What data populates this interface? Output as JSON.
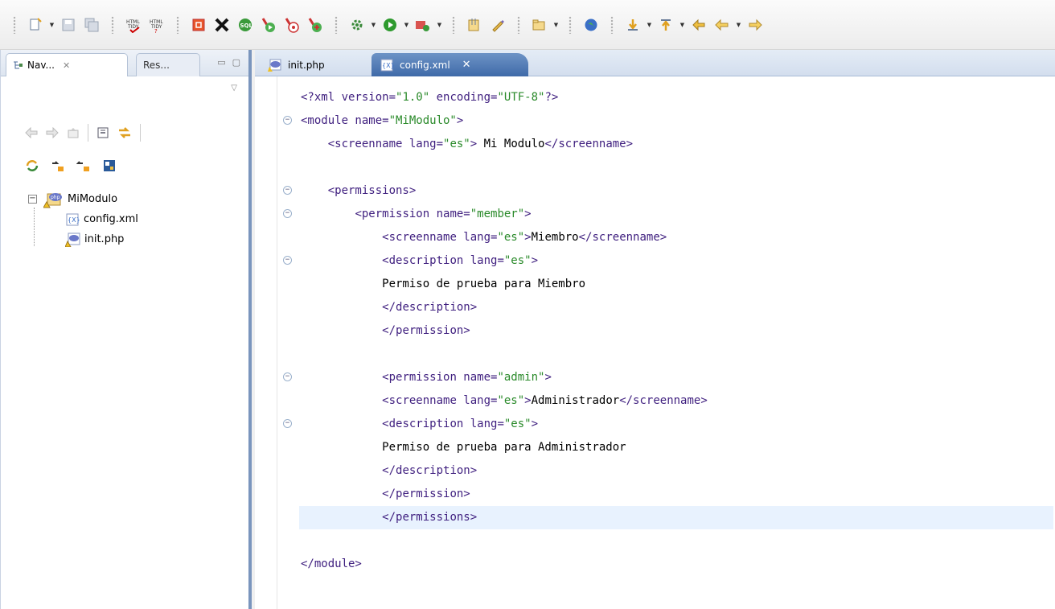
{
  "toolbar": {
    "groups": [
      [
        "new-wizard",
        "save",
        "save-all"
      ],
      [
        "html-tidy-fix",
        "html-tidy-check"
      ],
      [
        "open-app",
        "terminate",
        "sql-explorer",
        "run-php",
        "debug-php",
        "profile-php"
      ],
      [
        "settings",
        "run",
        "external-tools"
      ],
      [
        "open-resource",
        "spell-check"
      ],
      [
        "new-folder"
      ],
      [
        "browser"
      ],
      [
        "next-annotation",
        "previous-annotation",
        "last-edit",
        "back",
        "forward"
      ]
    ]
  },
  "navigator": {
    "tab_label": "Nav...",
    "tab_close": "✕",
    "other_tab_label": "Res...",
    "tree": {
      "project": "MiModulo",
      "files": [
        "config.xml",
        "init.php"
      ]
    }
  },
  "editor": {
    "tabs": [
      {
        "label": "init.php",
        "active": false
      },
      {
        "label": "config.xml",
        "active": true
      }
    ],
    "close_glyph": "✕",
    "lines": [
      "<?xml version=\"1.0\" encoding=\"UTF-8\"?>",
      "<module name=\"MiModulo\">",
      "    <screenname lang=\"es\"> Mi Modulo</screenname>",
      "",
      "    <permissions>",
      "        <permission name=\"member\">",
      "            <screenname lang=\"es\">Miembro</screenname>",
      "            <description lang=\"es\">",
      "            Permiso de prueba para Miembro",
      "            </description>",
      "            </permission>",
      "",
      "            <permission name=\"admin\">",
      "            <screenname lang=\"es\">Administrador</screenname>",
      "            <description lang=\"es\">",
      "            Permiso de prueba para Administrador",
      "            </description>",
      "            </permission>",
      "            </permissions>",
      "",
      "</module>"
    ],
    "fold_lines": [
      1,
      4,
      5,
      7,
      12,
      14
    ],
    "current_line": 18
  },
  "colors": {
    "tag": "#3f1f7f",
    "attr_value": "#2a8a2a",
    "current_line": "#e8f2fe",
    "active_tab": "#3f6aa8"
  }
}
